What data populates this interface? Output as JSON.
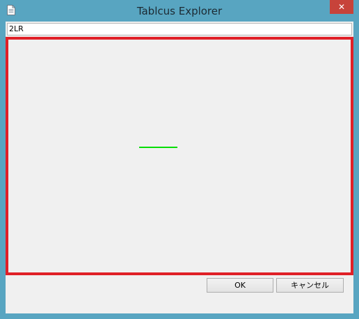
{
  "window": {
    "title": "Tablcus Explorer",
    "close_label": "✕",
    "app_icon": "document-icon"
  },
  "dialog": {
    "input_value": "2LR",
    "ok_label": "OK",
    "cancel_label": "キャンセル"
  },
  "colors": {
    "frame": "#58a5c1",
    "close": "#c7433a",
    "highlight": "#e02027",
    "line": "#00dd00"
  }
}
